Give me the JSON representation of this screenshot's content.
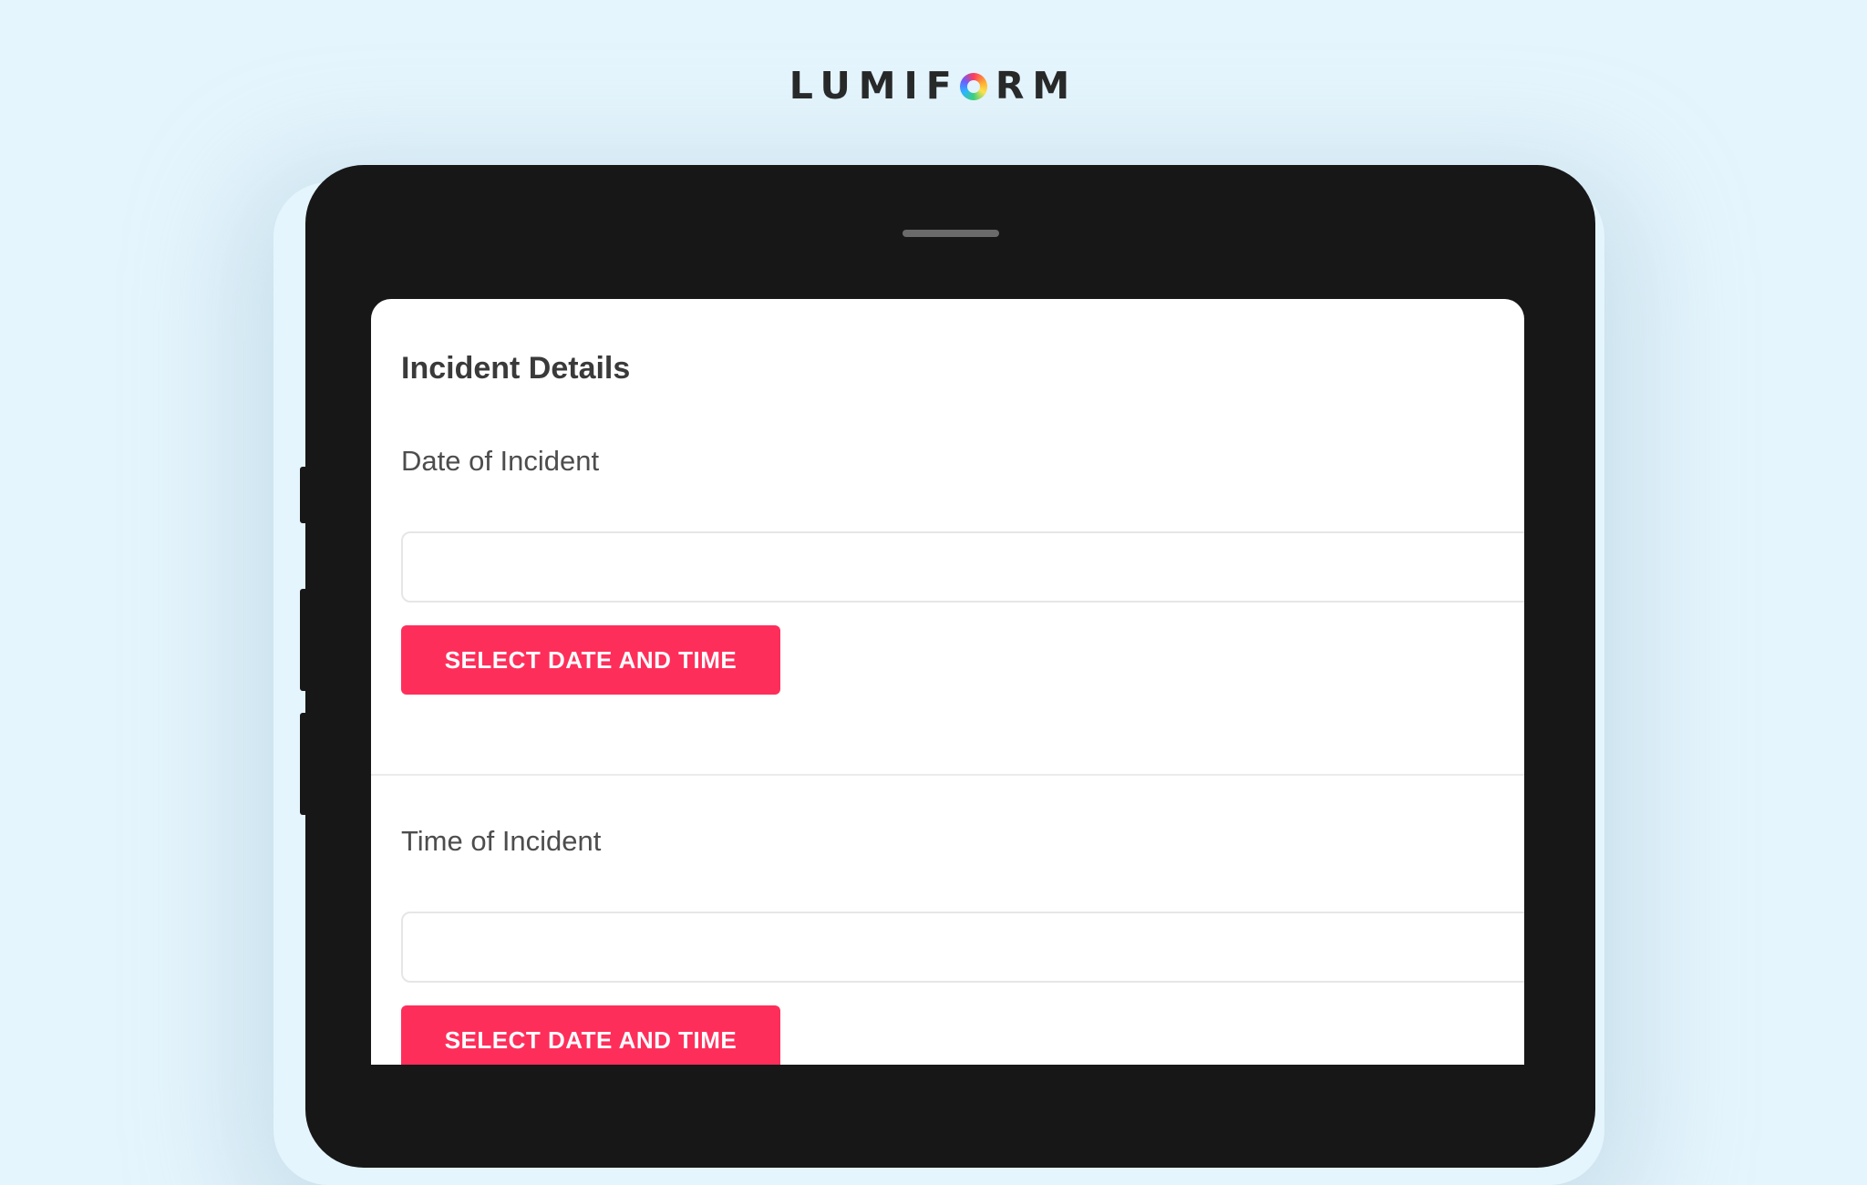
{
  "brand": {
    "logo_prefix": "LUMIF",
    "logo_suffix": "RM"
  },
  "form": {
    "section_title": "Incident Details",
    "fields": [
      {
        "label": "Date of Incident",
        "value": "",
        "button_label": "SELECT DATE AND TIME"
      },
      {
        "label": "Time of Incident",
        "value": "",
        "button_label": "SELECT DATE AND TIME"
      }
    ]
  },
  "colors": {
    "background": "#e5f5fd",
    "device": "#171717",
    "accent": "#fe2e5a",
    "title_text": "#3a3a3a"
  },
  "icons": {
    "logo_mark": "multicolor-ring-icon"
  }
}
